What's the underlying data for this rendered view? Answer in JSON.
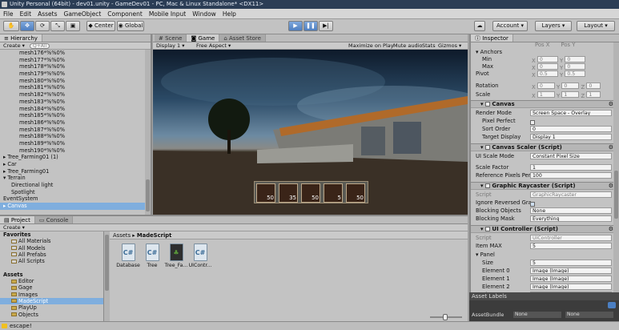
{
  "window": {
    "title": "Unity Personal (64bit) - dev01.unity - GameDev01 - PC, Mac & Linux Standalone* <DX11>"
  },
  "menu": [
    "File",
    "Edit",
    "Assets",
    "GameObject",
    "Component",
    "Mobile Input",
    "Window",
    "Help"
  ],
  "toolbar": {
    "center": "Center",
    "global": "Global",
    "account": "Account",
    "layers": "Layers",
    "layout": "Layout"
  },
  "hierarchy": {
    "tab": "Hierarchy",
    "create": "Create",
    "search_placeholder": "Q+All",
    "items": [
      {
        "label": "mesh176*%%0%",
        "indent": 2
      },
      {
        "label": "mesh177*%%0%",
        "indent": 2
      },
      {
        "label": "mesh178*%%0%",
        "indent": 2
      },
      {
        "label": "mesh179*%%0%",
        "indent": 2
      },
      {
        "label": "mesh180*%%0%",
        "indent": 2
      },
      {
        "label": "mesh181*%%0%",
        "indent": 2
      },
      {
        "label": "mesh182*%%0%",
        "indent": 2
      },
      {
        "label": "mesh183*%%0%",
        "indent": 2
      },
      {
        "label": "mesh184*%%0%",
        "indent": 2
      },
      {
        "label": "mesh185*%%0%",
        "indent": 2
      },
      {
        "label": "mesh186*%%0%",
        "indent": 2
      },
      {
        "label": "mesh187*%%0%",
        "indent": 2
      },
      {
        "label": "mesh188*%%0%",
        "indent": 2
      },
      {
        "label": "mesh189*%%0%",
        "indent": 2
      },
      {
        "label": "mesh190*%%0%",
        "indent": 2
      },
      {
        "label": "▸ Tree_Farming01 (1)",
        "indent": 0
      },
      {
        "label": "▸ Car",
        "indent": 0
      },
      {
        "label": "▸ Tree_Farming01",
        "indent": 0
      },
      {
        "label": "▾ Terrain",
        "indent": 0
      },
      {
        "label": "Directional light",
        "indent": 1
      },
      {
        "label": "Spotlight",
        "indent": 1
      },
      {
        "label": "EventSystem",
        "indent": 0
      },
      {
        "label": "▸ Canvas",
        "indent": 0,
        "selected": true
      }
    ]
  },
  "game": {
    "tabs": [
      "Scene",
      "Game",
      "Asset Store"
    ],
    "active_tab": "Game",
    "display": "Display 1",
    "aspect": "Free Aspect",
    "options": [
      "Maximize on Play",
      "Mute audio",
      "Stats",
      "Gizmos"
    ],
    "slots": [
      "50",
      "35",
      "50",
      "5",
      "50"
    ]
  },
  "inspector": {
    "tab": "Inspector",
    "rect": {
      "top_labels": [
        "Pos X",
        "Pos Y"
      ],
      "anchors": "Anchors",
      "min": "Min",
      "max": "Max",
      "pivot": "Pivot",
      "rotation": "Rotation",
      "scale": "Scale",
      "min_vals": [
        "X",
        "0",
        "Y",
        "0"
      ],
      "max_vals": [
        "X",
        "0",
        "Y",
        "0"
      ],
      "pivot_vals": [
        "X",
        "0.5",
        "Y",
        "0.5"
      ],
      "rot_vals": [
        "X",
        "0",
        "Y",
        "0",
        "Z",
        "0"
      ],
      "scale_vals": [
        "X",
        "1",
        "Y",
        "1",
        "Z",
        "1"
      ]
    },
    "canvas": {
      "title": "Canvas",
      "render_mode_label": "Render Mode",
      "render_mode": "Screen Space - Overlay",
      "pixel_perfect_label": "Pixel Perfect",
      "sort_order_label": "Sort Order",
      "sort_order": "0",
      "target_display_label": "Target Display",
      "target_display": "Display 1"
    },
    "scaler": {
      "title": "Canvas Scaler (Script)",
      "ui_scale_label": "UI Scale Mode",
      "ui_scale": "Constant Pixel Size",
      "scale_factor_label": "Scale Factor",
      "scale_factor": "1",
      "ref_ppu_label": "Reference Pixels Per",
      "ref_ppu": "100"
    },
    "raycaster": {
      "title": "Graphic Raycaster (Script)",
      "script_label": "Script",
      "script": "GraphicRaycaster",
      "ignore_label": "Ignore Reversed Gra",
      "blocking_objects_label": "Blocking Objects",
      "blocking_objects": "None",
      "blocking_mask_label": "Blocking Mask",
      "blocking_mask": "Everything"
    },
    "uicontroller": {
      "title": "UI Controller (Script)",
      "script_label": "Script",
      "script": "UIController",
      "item_max_label": "Item MAX",
      "item_max": "5",
      "panel_label": "Panel",
      "size_label": "Size",
      "size": "5",
      "elements": [
        {
          "label": "Element 0",
          "value": "Image (Image)"
        },
        {
          "label": "Element 1",
          "value": "Image (Image)"
        },
        {
          "label": "Element 2",
          "value": "Image (Image)"
        },
        {
          "label": "Element 3",
          "value": "Image (Image)"
        }
      ]
    },
    "asset_labels": "Asset Labels",
    "asset_bundle_label": "AssetBundle",
    "asset_bundle_values": [
      "None",
      "None"
    ]
  },
  "project": {
    "tabs": [
      "Project",
      "Console"
    ],
    "create": "Create",
    "tree": [
      {
        "label": "Favorites",
        "type": "header"
      },
      {
        "label": "All Materials",
        "type": "fav"
      },
      {
        "label": "All Models",
        "type": "fav"
      },
      {
        "label": "All Prefabs",
        "type": "fav"
      },
      {
        "label": "All Scripts",
        "type": "fav"
      },
      {
        "label": "",
        "type": "gap"
      },
      {
        "label": "Assets",
        "type": "header"
      },
      {
        "label": "Editor",
        "type": "folder"
      },
      {
        "label": "Gage",
        "type": "folder"
      },
      {
        "label": "Images",
        "type": "folder"
      },
      {
        "label": "MadeScript",
        "type": "folder",
        "selected": true
      },
      {
        "label": "PlayUp",
        "type": "folder"
      },
      {
        "label": "Objects",
        "type": "folder"
      }
    ],
    "breadcrumb": [
      "Assets",
      "MadeScript"
    ],
    "assets": [
      {
        "label": "Database",
        "kind": "script"
      },
      {
        "label": "Tree",
        "kind": "script"
      },
      {
        "label": "Tree_Fa...",
        "kind": "prefab"
      },
      {
        "label": "UIContr...",
        "kind": "script"
      }
    ]
  },
  "status": {
    "message": "escape!"
  }
}
